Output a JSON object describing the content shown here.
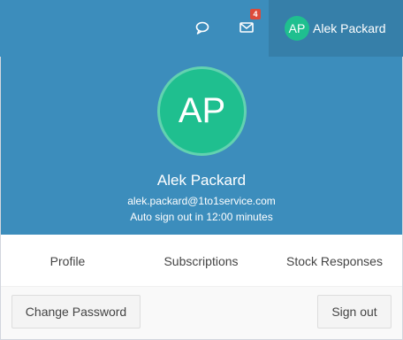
{
  "topbar": {
    "icons": [
      "chat-bubble-icon",
      "envelope-icon"
    ],
    "mail_badge": "4",
    "user_avatar_initials": "AP",
    "user_name": "Alek Packard"
  },
  "user_dropdown": {
    "avatar_initials": "AP",
    "name": "Alek Packard",
    "email": "alek.packard@1to1service.com",
    "auto_signout": "Auto sign out in 12:00 minutes",
    "links": {
      "profile": "Profile",
      "subscriptions": "Subscriptions",
      "stock_responses": "Stock Responses"
    },
    "footer": {
      "change_password": "Change Password",
      "sign_out": "Sign out"
    }
  },
  "colors": {
    "header_blue": "#3c8dbc",
    "user_menu_blue": "#367fa9",
    "avatar_green": "#1fbf8f",
    "badge_red": "#dd4b39"
  }
}
